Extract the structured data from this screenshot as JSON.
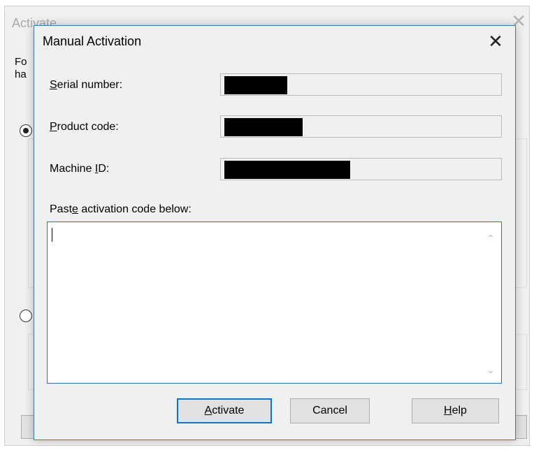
{
  "background_window": {
    "title": "Activate",
    "text_line1": "Fo",
    "text_line2": "ha"
  },
  "dialog": {
    "title": "Manual Activation",
    "close_glyph": "✕",
    "fields": [
      {
        "label_pre": "",
        "label_ul": "S",
        "label_post": "erial number:"
      },
      {
        "label_pre": "",
        "label_ul": "P",
        "label_post": "roduct code:"
      },
      {
        "label_pre": "Machine ",
        "label_ul": "I",
        "label_post": "D:"
      }
    ],
    "code_label": {
      "pre": "Past",
      "ul": "e",
      "post": " activation code below:"
    },
    "code_value": "",
    "buttons": {
      "activate": {
        "pre": "",
        "ul": "A",
        "post": "ctivate"
      },
      "cancel": "Cancel",
      "help": {
        "pre": "",
        "ul": "H",
        "post": "elp"
      }
    }
  },
  "icons": {
    "close": "close-icon",
    "scroll_up": "chevron-up-icon",
    "scroll_down": "chevron-down-icon"
  },
  "colors": {
    "accent": "#0078d7",
    "dialog_border": "#3a7ab8",
    "window_bg": "#f0f0f0",
    "redaction": "#000000"
  }
}
